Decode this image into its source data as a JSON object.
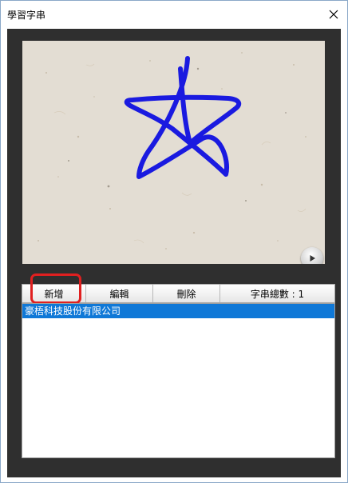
{
  "window": {
    "title": "學習字串"
  },
  "toolbar": {
    "add_label": "新增",
    "edit_label": "編輯",
    "delete_label": "刪除",
    "count_label": "字串總數 : 1"
  },
  "list": {
    "items": [
      {
        "label": "豪梧科技股份有限公司",
        "selected": true
      }
    ]
  },
  "icons": {
    "close": "close-icon",
    "play": "play-icon"
  },
  "colors": {
    "accent": "#0f78d7",
    "highlight": "#e02020",
    "stroke": "#1a1ae0",
    "panel": "#2f2f2f"
  }
}
